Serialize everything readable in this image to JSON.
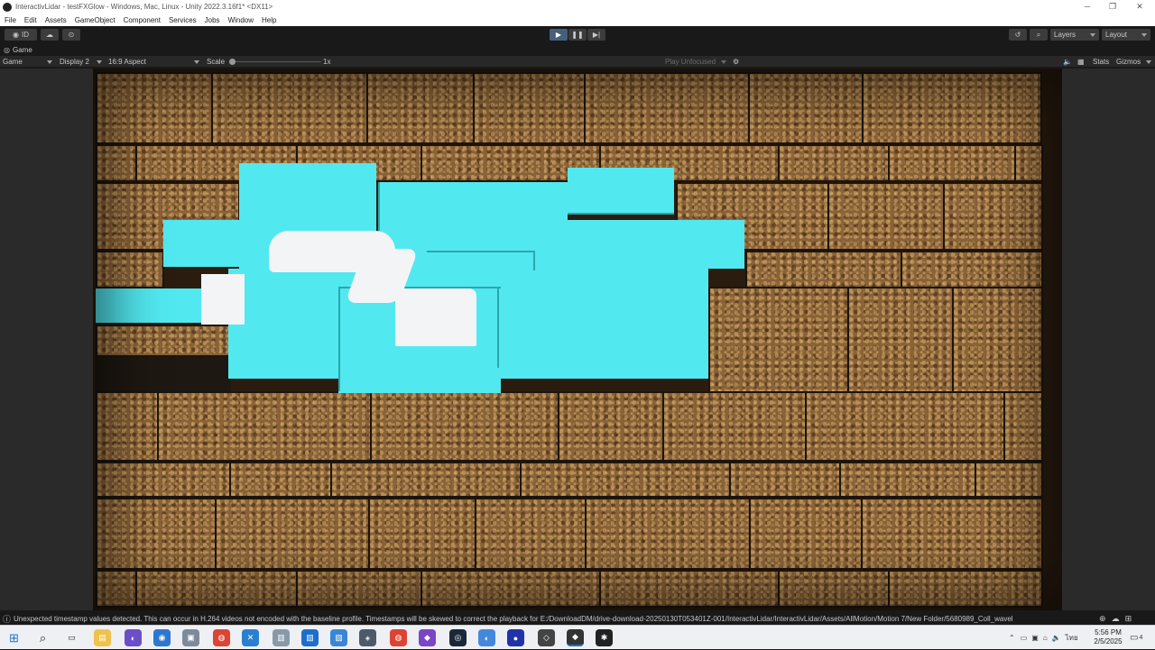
{
  "window": {
    "title": "InteractivLidar - testFXGlow - Windows, Mac, Linux - Unity 2022.3.16f1* <DX11>",
    "minimize": "─",
    "restore": "❐",
    "close": "✕"
  },
  "menu": [
    "File",
    "Edit",
    "Assets",
    "GameObject",
    "Component",
    "Services",
    "Jobs",
    "Window",
    "Help"
  ],
  "toolbar": {
    "account_label": "ID",
    "layers_label": "Layers",
    "layout_label": "Layout"
  },
  "tab": {
    "label": "Game"
  },
  "gamebar": {
    "game_select": "Game",
    "display_select": "Display 2",
    "aspect_select": "16:9 Aspect",
    "scale_label": "Scale",
    "scale_value": "1x",
    "play_mode": "Play Unfocused",
    "stats_label": "Stats",
    "gizmos_label": "Gizmos"
  },
  "status": {
    "message": "Unexpected timestamp values detected. This can occur in H.264 videos not encoded with the baseline profile. Timestamps will be skewed to correct the playback for E:/DownloadDM/drive-download-20250130T053401Z-001/InteractivLidar/InteractivLidar/Assets/AllMotion/Motion 7/New Folder/5680989_Coll_wavel"
  },
  "taskbar": {
    "lang": "ไทย",
    "time": "5:56 PM",
    "date": "2/5/2025",
    "notifications": "4"
  },
  "colors": {
    "editor_bg": "#191919",
    "panel_bg": "#282828",
    "glow_cyan": "#52e8f0",
    "brick_brown": "#8a6238",
    "mortar": "#1d150d"
  }
}
